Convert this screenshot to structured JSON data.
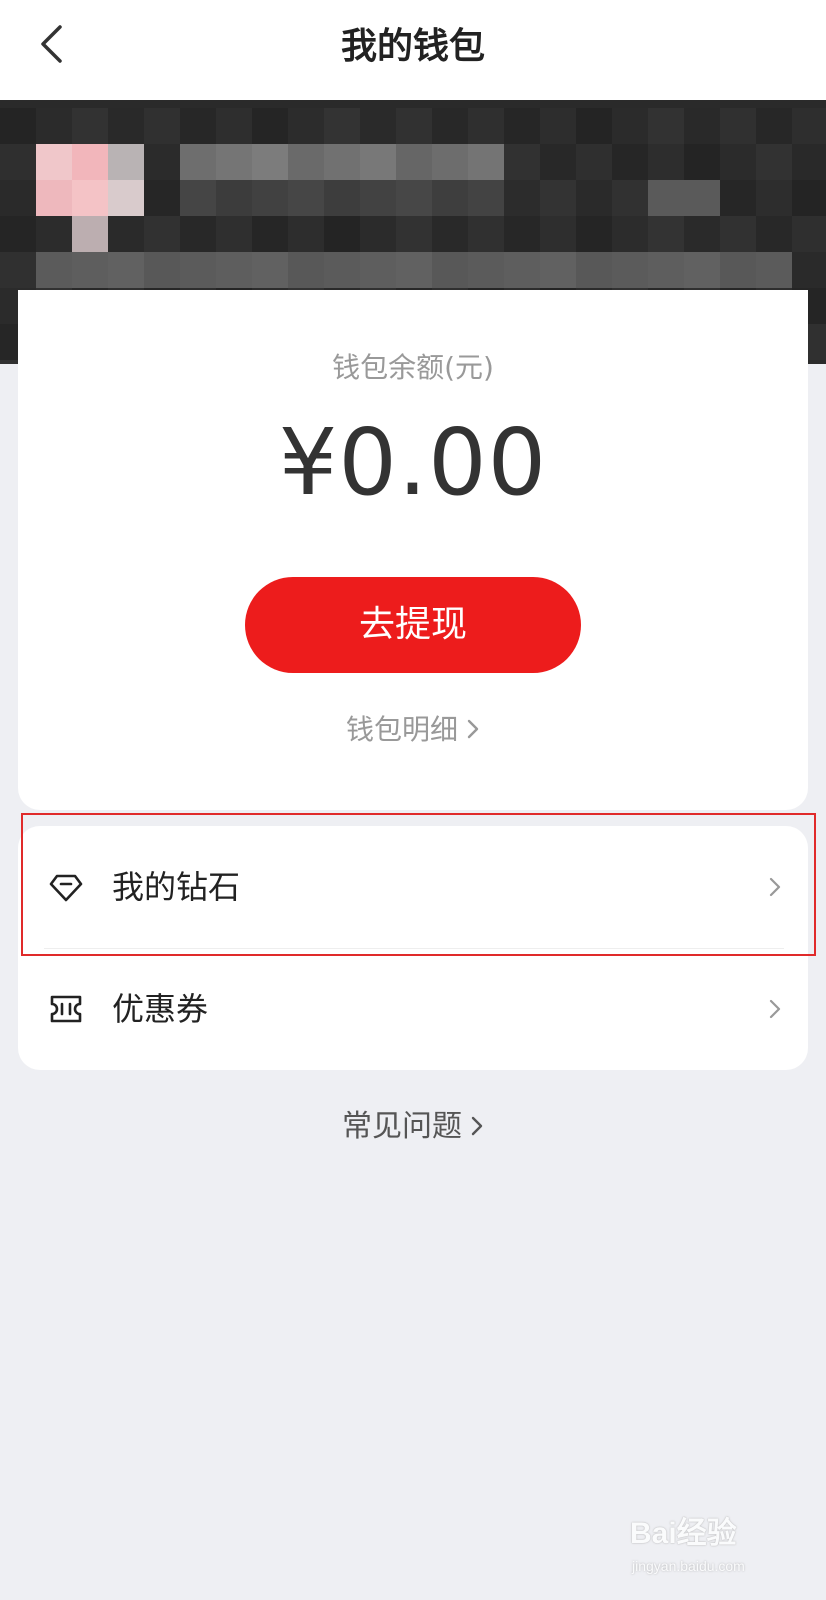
{
  "header": {
    "title": "我的钱包",
    "back_icon": "chevron-left-icon"
  },
  "banner": {
    "state": "pixelated / censored user info"
  },
  "wallet": {
    "balance_label": "钱包余额(元)",
    "balance_amount": "¥0.00",
    "withdraw_label": "去提现",
    "detail_label": "钱包明细",
    "accent_color": "#ed1c1c"
  },
  "menu": {
    "items": [
      {
        "label": "我的钻石",
        "icon": "diamond-icon"
      },
      {
        "label": "优惠券",
        "icon": "coupon-icon"
      }
    ]
  },
  "faq": {
    "label": "常见问题"
  },
  "watermark": {
    "logo": "Bai经验",
    "url": "jingyan.baidu.com"
  }
}
